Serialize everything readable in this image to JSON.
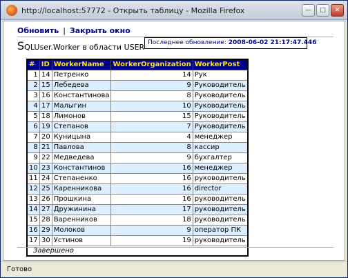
{
  "window": {
    "title": "http://localhost:57772 - Открыть таблицу - Mozilla Firefox"
  },
  "toolbar": {
    "refresh_label": "Обновить",
    "separator": "|",
    "close_label": "Закрыть окно"
  },
  "heading": {
    "initial": "S",
    "rest": "QLUser.Worker в области USER"
  },
  "update": {
    "label": "Последнее обновление:",
    "timestamp": "2008-06-02 21:17:47.446"
  },
  "table": {
    "columns": [
      "#",
      "ID",
      "WorkerName",
      "WorkerOrganization",
      "WorkerPost"
    ],
    "rows": [
      [
        "1",
        "14",
        "Петренко",
        "14",
        "Рук"
      ],
      [
        "2",
        "15",
        "Лебедева",
        "9",
        "Руководитель"
      ],
      [
        "3",
        "16",
        "Константинова",
        "8",
        "Руководитель"
      ],
      [
        "4",
        "17",
        "Малыгин",
        "10",
        "Руководитель"
      ],
      [
        "5",
        "18",
        "Лимонов",
        "15",
        "Руководитель"
      ],
      [
        "6",
        "19",
        "Степанов",
        "7",
        "Руководитель"
      ],
      [
        "7",
        "20",
        "Куницына",
        "4",
        "менеджер"
      ],
      [
        "8",
        "21",
        "Павлова",
        "8",
        "кассир"
      ],
      [
        "9",
        "22",
        "Медведева",
        "9",
        "бухгалтер"
      ],
      [
        "10",
        "23",
        "Константинов",
        "16",
        "менеджер"
      ],
      [
        "11",
        "24",
        "Степаненко",
        "16",
        "руководитель"
      ],
      [
        "12",
        "25",
        "Каренникова",
        "16",
        "director"
      ],
      [
        "13",
        "26",
        "Прошкина",
        "16",
        "руководитель"
      ],
      [
        "14",
        "27",
        "Дружинина",
        "17",
        "руководитель"
      ],
      [
        "15",
        "28",
        "Варенников",
        "18",
        "руководитель"
      ],
      [
        "16",
        "29",
        "Молоков",
        "9",
        "оператор ПК"
      ],
      [
        "17",
        "30",
        "Устинов",
        "19",
        "руководитель"
      ]
    ],
    "footer": "Завершено"
  },
  "status": {
    "text": "Готово"
  }
}
